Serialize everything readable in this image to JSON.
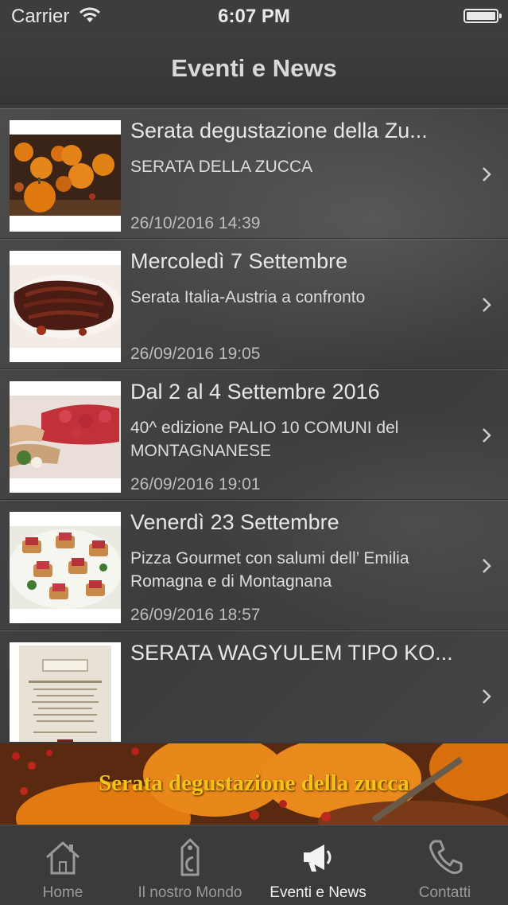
{
  "status_bar": {
    "carrier": "Carrier",
    "time": "6:07 PM"
  },
  "nav": {
    "title": "Eventi e News"
  },
  "events": [
    {
      "title": "Serata degustazione della Zu...",
      "subtitle": "SERATA DELLA ZUCCA",
      "date": "26/10/2016 14:39"
    },
    {
      "title": "Mercoledì 7 Settembre",
      "subtitle": "Serata Italia-Austria a confronto",
      "date": "26/09/2016 19:05"
    },
    {
      "title": "Dal 2 al 4 Settembre 2016",
      "subtitle": "40^ edizione PALIO 10 COMUNI del MONTAGNANESE",
      "date": "26/09/2016 19:01"
    },
    {
      "title": "Venerdì 23 Settembre",
      "subtitle": "Pizza Gourmet con salumi dell’ Emilia Romagna e di Montagnana",
      "date": "26/09/2016 18:57"
    },
    {
      "title": "SERATA WAGYULEM TIPO KO...",
      "subtitle": "",
      "date": ""
    }
  ],
  "banner": {
    "text": "Serata degustazione della zucca"
  },
  "tabs": [
    {
      "label": "Home",
      "icon": "home-icon"
    },
    {
      "label": "Il nostro Mondo",
      "icon": "tag-icon"
    },
    {
      "label": "Eventi e News",
      "icon": "megaphone-icon"
    },
    {
      "label": "Contatti",
      "icon": "phone-icon"
    }
  ],
  "colors": {
    "background": "#3a3a3a",
    "banner_text": "#f2c418",
    "active_tab": "#f2f2f2",
    "inactive_tab": "#9a9a9a"
  }
}
